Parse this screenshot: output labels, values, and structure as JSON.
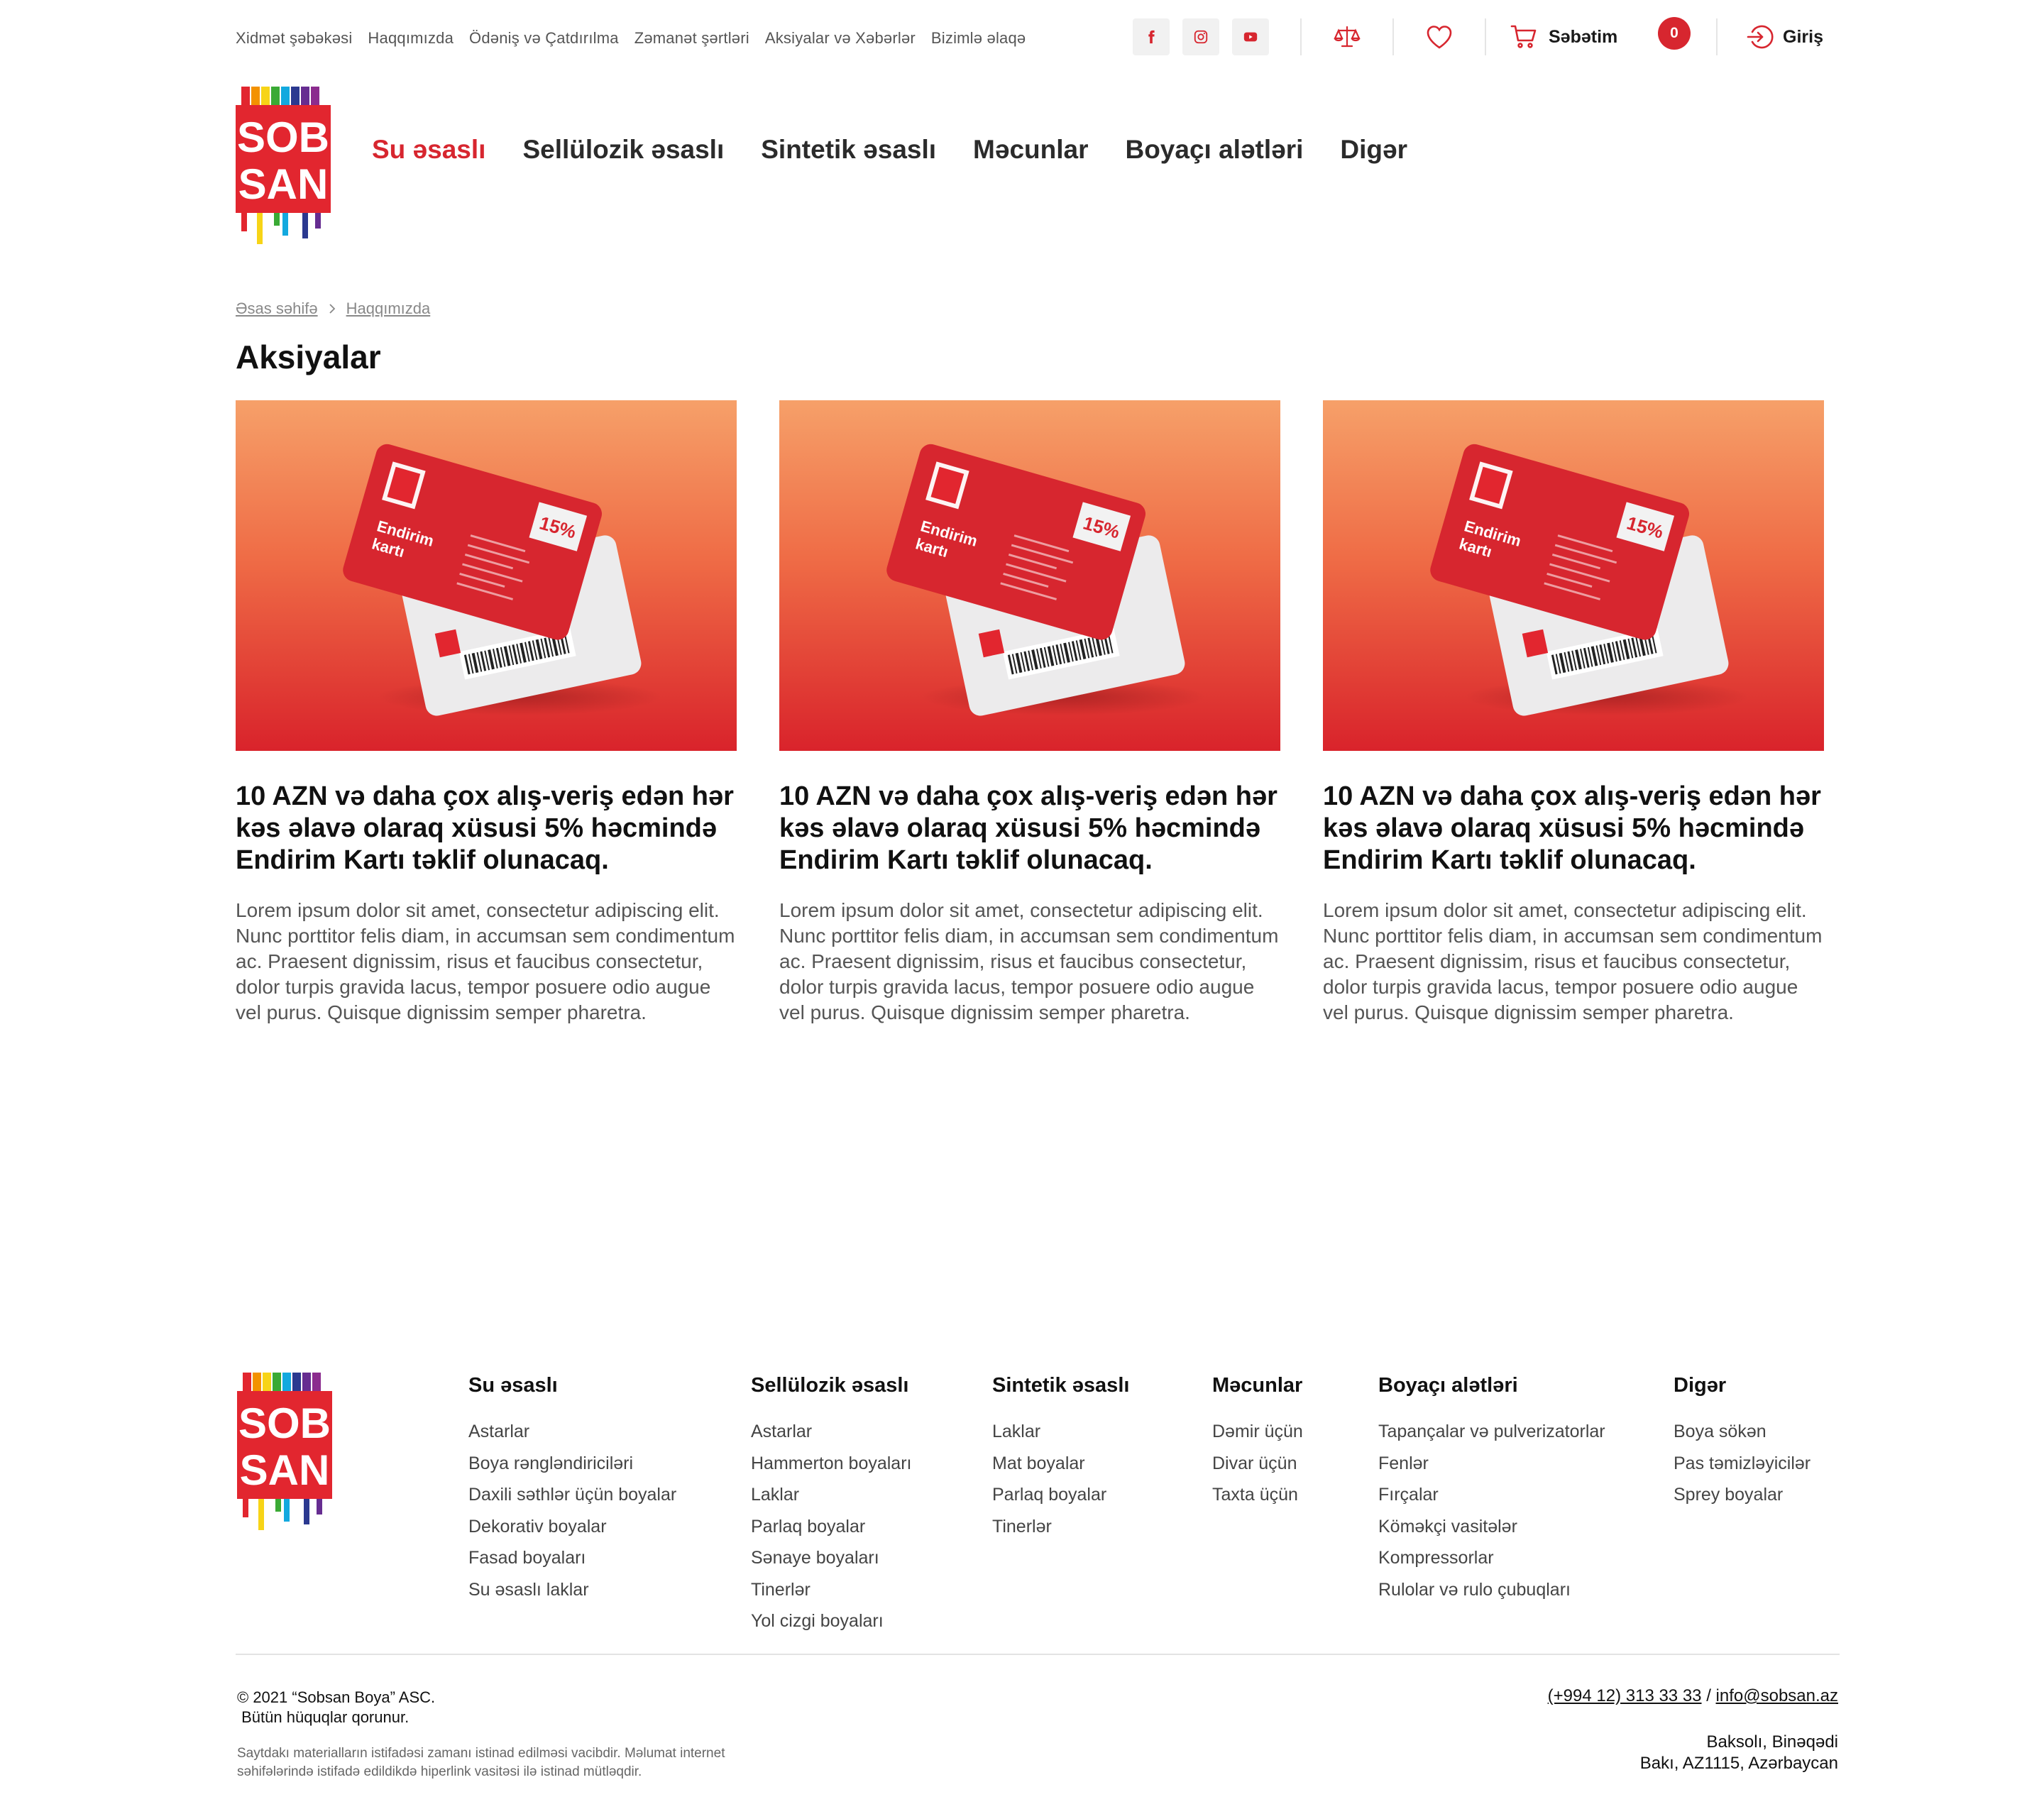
{
  "top_links": [
    "Xidmət şəbəkəsi",
    "Haqqımızda",
    "Ödəniş və Çatdırılma",
    "Zəmanət şərtləri",
    "Aksiyalar və Xəbərlər",
    "Bizimlə əlaqə"
  ],
  "social": [
    "facebook-icon",
    "instagram-icon",
    "youtube-icon"
  ],
  "cart": {
    "label": "Səbətim",
    "count": "0"
  },
  "login": {
    "label": "Giriş"
  },
  "logo": {
    "line1": "SOB",
    "line2": "SAN"
  },
  "nav": [
    "Su əsaslı",
    "Sellülozik əsaslı",
    "Sintetik əsaslı",
    "Məcunlar",
    "Boyaçı alətləri",
    "Digər"
  ],
  "breadcrumb": [
    "Əsas səhifə",
    "Haqqımızda"
  ],
  "page_title": "Aksiyalar",
  "promo_card": {
    "label_line1": "Endirim",
    "label_line2": "kartı",
    "discount": "15%"
  },
  "cards": [
    {
      "title": "10 AZN və daha çox alış-veriş edən hər kəs əlavə olaraq xüsusi 5% həcmində Endirim Kartı təklif olunacaq.",
      "text": "Lorem ipsum dolor sit amet, consectetur adipiscing elit. Nunc porttitor felis diam, in accumsan sem condimentum ac. Praesent dignissim, risus et faucibus consectetur, dolor turpis gravida lacus, tempor posuere odio augue vel purus. Quisque dignissim semper pharetra."
    },
    {
      "title": "10 AZN və daha çox alış-veriş edən hər kəs əlavə olaraq xüsusi 5% həcmində Endirim Kartı təklif olunacaq.",
      "text": "Lorem ipsum dolor sit amet, consectetur adipiscing elit. Nunc porttitor felis diam, in accumsan sem condimentum ac. Praesent dignissim, risus et faucibus consectetur, dolor turpis gravida lacus, tempor posuere odio augue vel purus. Quisque dignissim semper pharetra."
    },
    {
      "title": "10 AZN və daha çox alış-veriş edən hər kəs əlavə olaraq xüsusi 5% həcmində Endirim Kartı təklif olunacaq.",
      "text": "Lorem ipsum dolor sit amet, consectetur adipiscing elit. Nunc porttitor felis diam, in accumsan sem condimentum ac. Praesent dignissim, risus et faucibus consectetur, dolor turpis gravida lacus, tempor posuere odio augue vel purus. Quisque dignissim semper pharetra."
    }
  ],
  "footer_columns": [
    {
      "title": "Su əsaslı",
      "items": [
        "Astarlar",
        "Boya rəngləndiriciləri",
        "Daxili səthlər üçün boyalar",
        "Dekorativ boyalar",
        "Fasad boyaları",
        "Su əsaslı laklar"
      ]
    },
    {
      "title": "Sellülozik əsaslı",
      "items": [
        "Astarlar",
        "Hammerton boyaları",
        "Laklar",
        "Parlaq boyalar",
        "Sənaye boyaları",
        "Tinerlər",
        "Yol cizgi boyaları"
      ]
    },
    {
      "title": "Sintetik əsaslı",
      "items": [
        "Laklar",
        "Mat boyalar",
        "Parlaq boyalar",
        "Tinerlər"
      ]
    },
    {
      "title": "Məcunlar",
      "items": [
        "Dəmir üçün",
        "Divar üçün",
        "Taxta üçün"
      ]
    },
    {
      "title": "Boyaçı alətləri",
      "items": [
        "Tapançalar və pulverizatorlar",
        "Fenlər",
        "Fırçalar",
        "Köməkçi vasitələr",
        "Kompressorlar",
        "Rulolar və rulo çubuqları"
      ]
    },
    {
      "title": "Digər",
      "items": [
        "Boya sökən",
        "Pas təmizləyicilər",
        "Sprey boyalar"
      ]
    }
  ],
  "footer": {
    "copyright_line1": "© 2021 “Sobsan Boya”  ASC.",
    "copyright_line2": " Bütün hüquqlar qorunur.",
    "notice_line1": "Saytdakı materialların istifadəsi zamanı istinad edilməsi vacibdir. Məlumat internet",
    "notice_line2": "səhifələrində istifadə edildikdə hiperlink vasitəsi ilə istinad mütləqdir.",
    "phone": "(+994 12) 313 33 33",
    "separator": "/",
    "email": "info@sobsan.az",
    "address_line1": "Baksolı, Binəqədi",
    "address_line2": "Bakı, AZ1115, Azərbaycan"
  },
  "colors": {
    "accent": "#d7262f",
    "text": "#111111",
    "muted": "#555555"
  }
}
